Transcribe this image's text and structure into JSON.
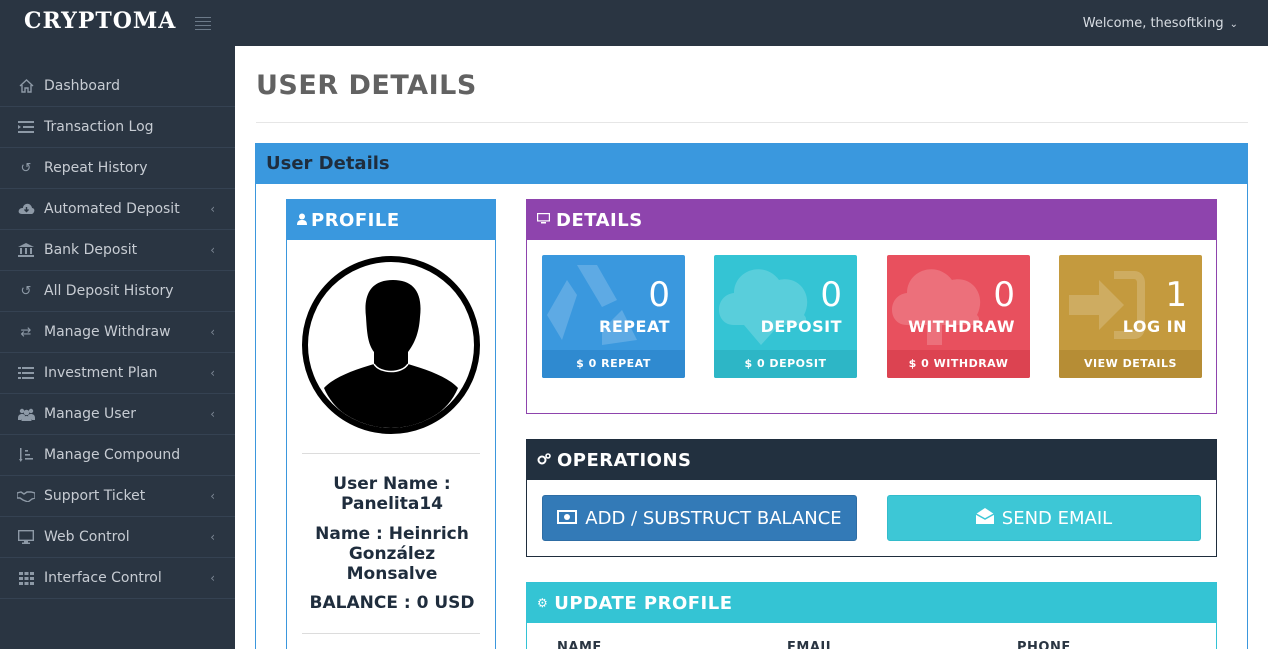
{
  "app": {
    "logo": "CRYPTOMA",
    "welcome": "Welcome, thesoftking"
  },
  "sidebar": {
    "items": [
      {
        "label": "Dashboard",
        "icon": "home-icon",
        "has_submenu": false
      },
      {
        "label": "Transaction Log",
        "icon": "list-indent-icon",
        "has_submenu": false
      },
      {
        "label": "Repeat History",
        "icon": "history-icon",
        "has_submenu": false
      },
      {
        "label": "Automated Deposit",
        "icon": "cloud-download-icon",
        "has_submenu": true
      },
      {
        "label": "Bank Deposit",
        "icon": "bank-icon",
        "has_submenu": true
      },
      {
        "label": "All Deposit History",
        "icon": "history-icon",
        "has_submenu": false
      },
      {
        "label": "Manage Withdraw",
        "icon": "exchange-icon",
        "has_submenu": true
      },
      {
        "label": "Investment Plan",
        "icon": "list-icon",
        "has_submenu": true
      },
      {
        "label": "Manage User",
        "icon": "users-icon",
        "has_submenu": true
      },
      {
        "label": "Manage Compound",
        "icon": "sort-amount-icon",
        "has_submenu": false
      },
      {
        "label": "Support Ticket",
        "icon": "handshake-icon",
        "has_submenu": true
      },
      {
        "label": "Web Control",
        "icon": "desktop-icon",
        "has_submenu": true
      },
      {
        "label": "Interface Control",
        "icon": "grid-icon",
        "has_submenu": true
      }
    ]
  },
  "page": {
    "title": "USER DETAILS",
    "panel_title": "User Details"
  },
  "profile": {
    "title": "PROFILE",
    "username_line1": "User Name :",
    "username_line2": "Panelita14",
    "name_line1": "Name : Heinrich",
    "name_line2": "González",
    "name_line3": "Monsalve",
    "balance": "BALANCE : 0 USD"
  },
  "details": {
    "title": "DETAILS",
    "tiles": [
      {
        "count": "0",
        "label": "REPEAT",
        "footer": "$ 0 REPEAT",
        "color": "#3a98de",
        "footer_color": "#2f8ad0",
        "icon": "recycle-icon"
      },
      {
        "count": "0",
        "label": "DEPOSIT",
        "footer": "$ 0 DEPOSIT",
        "color": "#34c4d4",
        "footer_color": "#2db6c6",
        "icon": "cloud-download-icon"
      },
      {
        "count": "0",
        "label": "WITHDRAW",
        "footer": "$ 0 WITHDRAW",
        "color": "#e8505e",
        "footer_color": "#dc4351",
        "icon": "cloud-upload-icon"
      },
      {
        "count": "1",
        "label": "LOG IN",
        "footer": "VIEW DETAILS",
        "color": "#c49a3e",
        "footer_color": "#b68d35",
        "icon": "sign-in-icon"
      }
    ]
  },
  "operations": {
    "title": "OPERATIONS",
    "add_balance_label": "ADD / SUBSTRUCT BALANCE",
    "send_email_label": "SEND EMAIL"
  },
  "update_profile": {
    "title": "UPDATE PROFILE",
    "columns": [
      "NAME",
      "EMAIL",
      "PHONE"
    ]
  },
  "colors": {
    "sidebar_bg": "#2a3542",
    "primary": "#3a98de",
    "purple": "#8e44ad",
    "dark": "#22303f",
    "info": "#34c4d4"
  }
}
